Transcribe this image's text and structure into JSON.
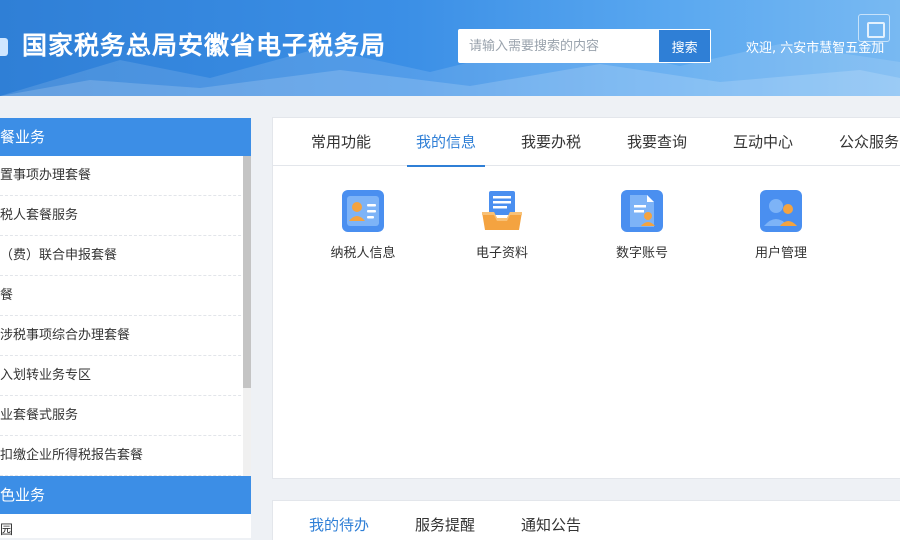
{
  "header": {
    "title": "国家税务总局安徽省电子税务局",
    "search": {
      "placeholder": "请输入需要搜索的内容",
      "button": "搜索"
    },
    "welcome": "欢迎,   六安市慧智五金加"
  },
  "sidebar": {
    "section1": "餐业务",
    "items": [
      "置事项办理套餐",
      "税人套餐服务",
      "（费）联合申报套餐",
      "餐",
      "涉税事项综合办理套餐",
      "入划转业务专区",
      "业套餐式服务",
      "扣缴企业所得税报告套餐"
    ],
    "section2": "色业务",
    "items2": [
      "园"
    ]
  },
  "main": {
    "tabs": [
      {
        "label": "常用功能"
      },
      {
        "label": "我的信息",
        "active": true
      },
      {
        "label": "我要办税"
      },
      {
        "label": "我要查询"
      },
      {
        "label": "互动中心"
      },
      {
        "label": "公众服务"
      }
    ],
    "tiles": [
      {
        "label": "纳税人信息",
        "icon": "taxpayer-card-icon"
      },
      {
        "label": "电子资料",
        "icon": "file-tray-icon"
      },
      {
        "label": "数字账号",
        "icon": "document-user-icon"
      },
      {
        "label": "用户管理",
        "icon": "users-icon"
      }
    ]
  },
  "bottom": {
    "tabs": [
      {
        "label": "我的待办",
        "active": true
      },
      {
        "label": "服务提醒"
      },
      {
        "label": "通知公告"
      }
    ]
  },
  "colors": {
    "header_blue": "#2f7fd6",
    "accent": "#2f7fd6",
    "sidebar_header": "#3c8ee6",
    "icon_blue": "#4a8ff0",
    "icon_orange": "#f4a340"
  }
}
